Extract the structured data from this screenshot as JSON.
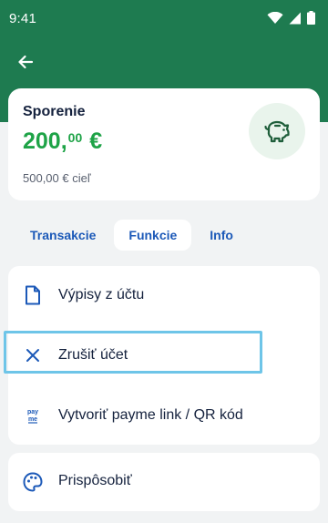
{
  "status_bar": {
    "time": "9:41"
  },
  "account": {
    "name": "Sporenie",
    "balance_whole": "200,",
    "balance_cents": "00",
    "currency": "€",
    "goal": "500,00 € cieľ",
    "icon": "piggy-bank-icon"
  },
  "tabs": [
    {
      "label": "Transakcie",
      "active": false
    },
    {
      "label": "Funkcie",
      "active": true
    },
    {
      "label": "Info",
      "active": false
    }
  ],
  "menu": {
    "items": [
      {
        "label": "Výpisy z účtu",
        "icon": "document-icon"
      },
      {
        "label": "Zrušiť účet",
        "icon": "close-icon"
      },
      {
        "label": "Vytvoriť payme link / QR kód",
        "icon": "payme-icon"
      }
    ],
    "payme_icon_text": "pay\nme"
  },
  "customize": {
    "label": "Prispôsobiť",
    "icon": "palette-icon"
  },
  "colors": {
    "header_green": "#1e7b50",
    "balance_green": "#1ea347",
    "link_blue": "#1c59b8",
    "highlight": "#6ec5e8"
  }
}
